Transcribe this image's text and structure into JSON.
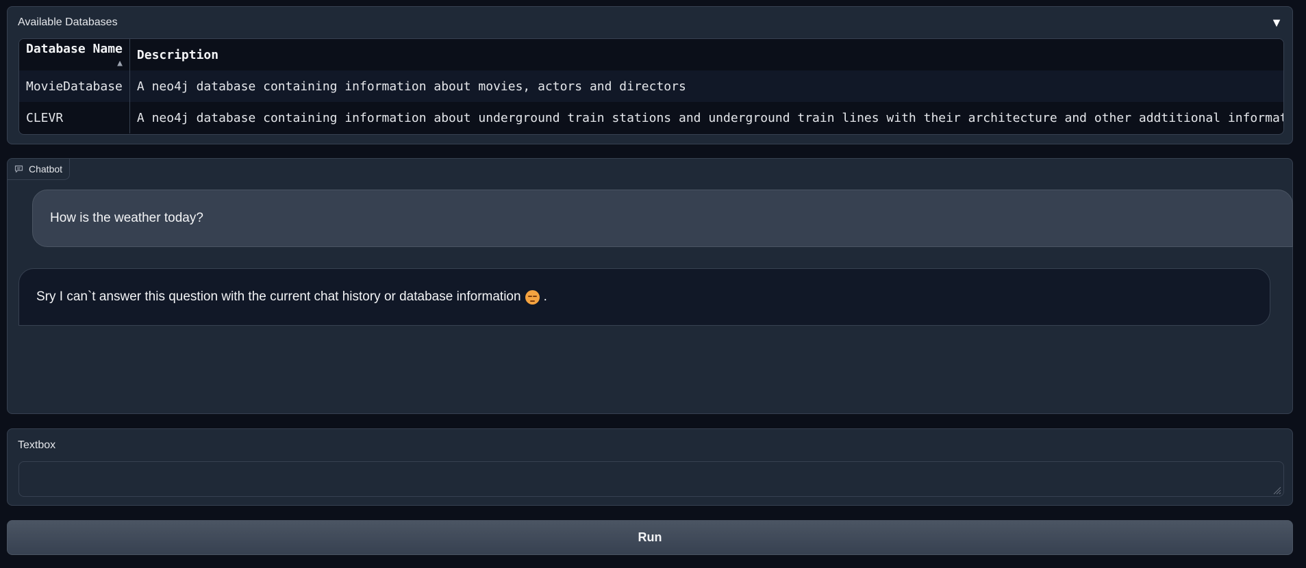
{
  "databases": {
    "header": "Available Databases",
    "toggle_icon": "▼",
    "columns": [
      "Database Name",
      "Description"
    ],
    "sort_indicator": "▲",
    "rows": [
      {
        "name": "MovieDatabase",
        "description": "A neo4j database containing information about movies, actors and directors"
      },
      {
        "name": "CLEVR",
        "description": "A neo4j database containing information about underground train stations and underground train lines with their architecture and other addtitional information"
      }
    ]
  },
  "chatbot": {
    "label": "Chatbot",
    "icon": "chat-bubble-icon",
    "messages": [
      {
        "role": "user",
        "text": "How is the weather today?"
      },
      {
        "role": "bot",
        "text": "Sry I can`t answer this question with the current chat history or database information",
        "emoji": "pensive-face",
        "suffix": "."
      }
    ]
  },
  "textbox": {
    "label": "Textbox",
    "value": "",
    "placeholder": ""
  },
  "run_button": {
    "label": "Run"
  },
  "colors": {
    "background": "#0b0f19",
    "panel": "#1f2937",
    "border": "#374151",
    "user_bubble": "#374151",
    "bot_bubble": "#111827"
  }
}
